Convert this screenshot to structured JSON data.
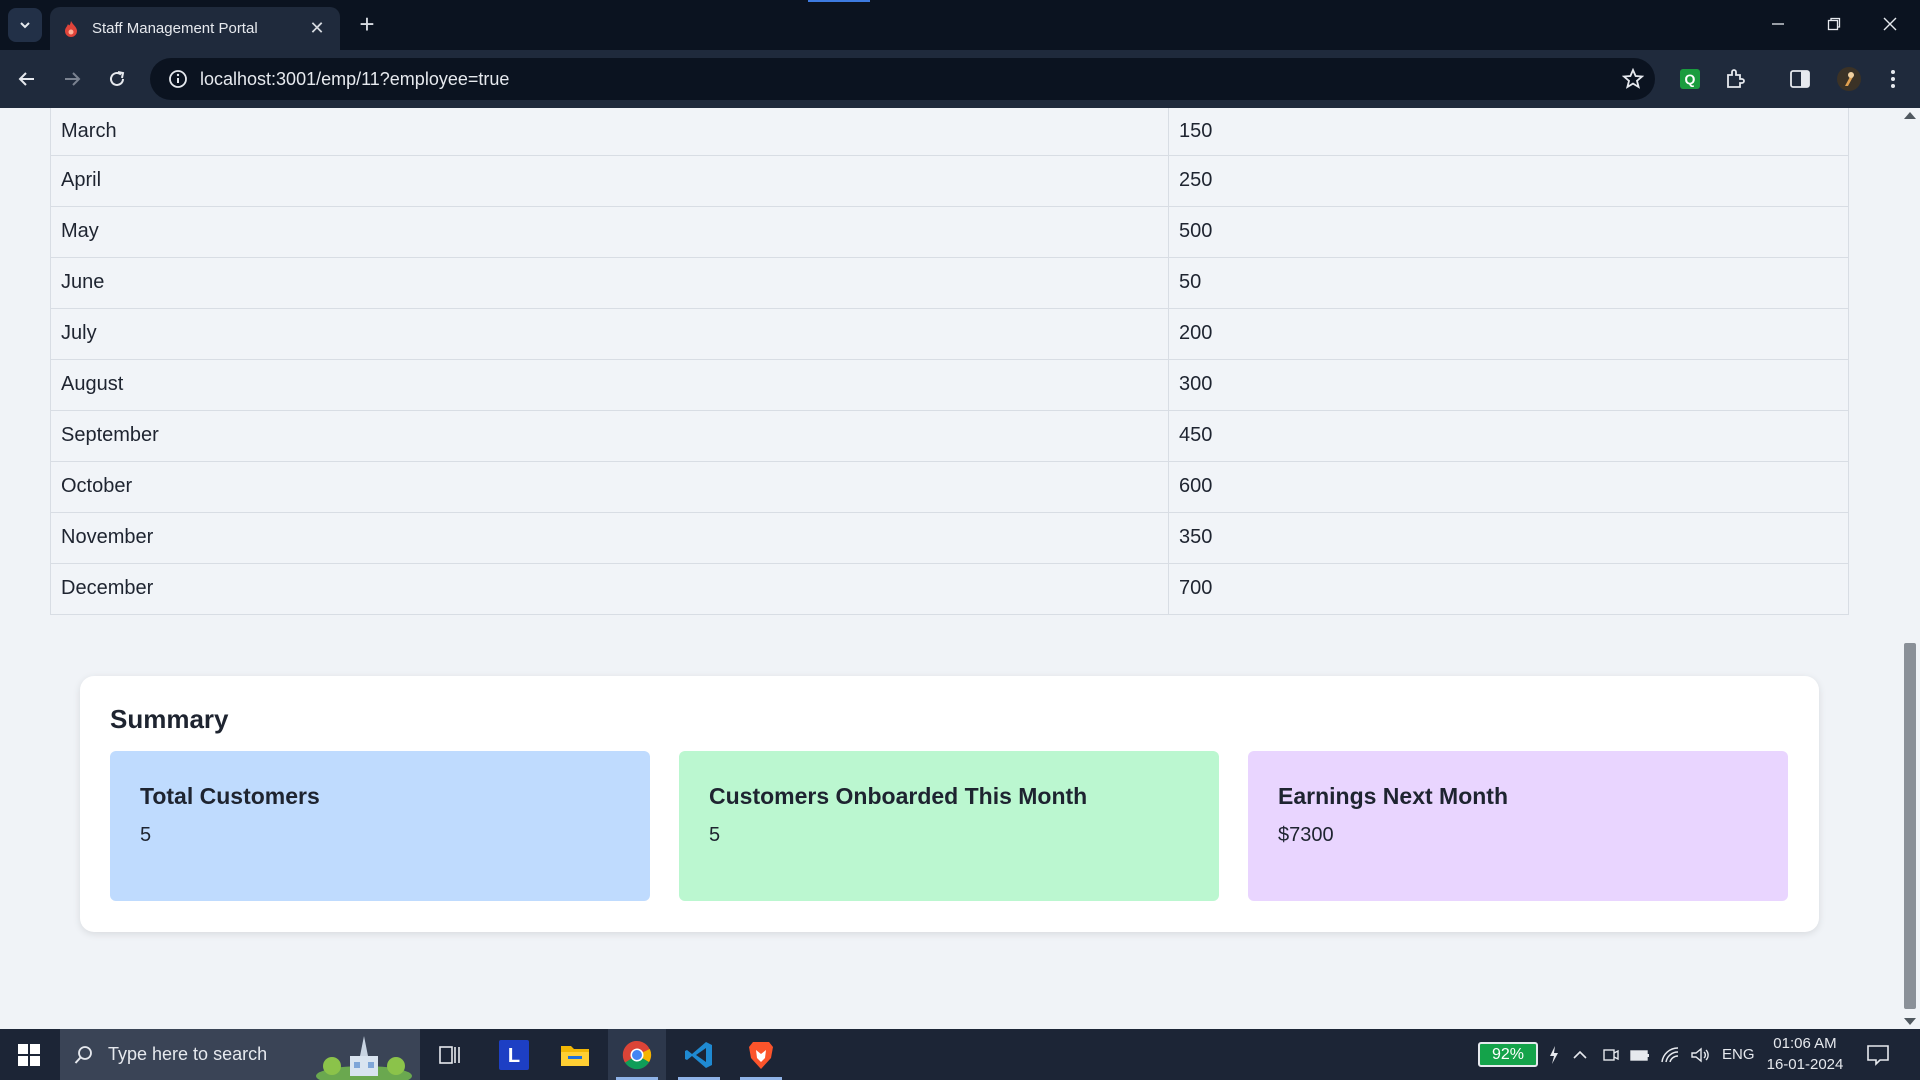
{
  "browser": {
    "tab_title": "Staff Management Portal",
    "url": "localhost:3001/emp/11?employee=true"
  },
  "table": {
    "rows": [
      {
        "month": "March",
        "value": "150"
      },
      {
        "month": "April",
        "value": "250"
      },
      {
        "month": "May",
        "value": "500"
      },
      {
        "month": "June",
        "value": "50"
      },
      {
        "month": "July",
        "value": "200"
      },
      {
        "month": "August",
        "value": "300"
      },
      {
        "month": "September",
        "value": "450"
      },
      {
        "month": "October",
        "value": "600"
      },
      {
        "month": "November",
        "value": "350"
      },
      {
        "month": "December",
        "value": "700"
      }
    ]
  },
  "summary": {
    "title": "Summary",
    "cards": [
      {
        "label": "Total Customers",
        "value": "5",
        "color": "#bfdbfe"
      },
      {
        "label": "Customers Onboarded This Month",
        "value": "5",
        "color": "#bbf7d0"
      },
      {
        "label": "Earnings Next Month",
        "value": "$7300",
        "color": "#e9d5ff"
      }
    ]
  },
  "taskbar": {
    "search_placeholder": "Type here to search",
    "apps": [
      "task-view-icon",
      "l-app-icon",
      "file-explorer-icon",
      "chrome-icon",
      "vscode-icon",
      "brave-icon"
    ],
    "battery": "92%",
    "language": "ENG",
    "time": "01:06 AM",
    "date": "16-01-2024"
  }
}
